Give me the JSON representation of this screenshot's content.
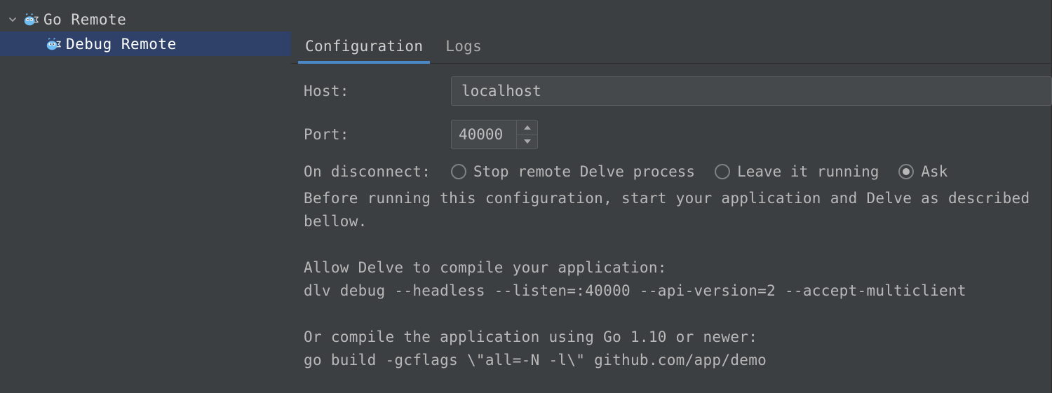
{
  "sidebar": {
    "nodes": [
      {
        "label": "Go Remote",
        "expanded": true
      },
      {
        "label": "Debug Remote",
        "selected": true
      }
    ]
  },
  "main": {
    "tabs": [
      {
        "label": "Configuration",
        "active": true
      },
      {
        "label": "Logs",
        "active": false
      }
    ],
    "host_label": "Host:",
    "host_value": "localhost",
    "port_label": "Port:",
    "port_value": "40000",
    "on_disconnect_label": "On disconnect:",
    "on_disconnect_options": [
      {
        "label": "Stop remote Delve process",
        "selected": false
      },
      {
        "label": "Leave it running",
        "selected": false
      },
      {
        "label": "Ask",
        "selected": true
      }
    ],
    "instructions_text": "Before running this configuration, start your application and Delve as described bellow.\n\nAllow Delve to compile your application:\ndlv debug --headless --listen=:40000 --api-version=2 --accept-multiclient\n\nOr compile the application using Go 1.10 or newer:\ngo build -gcflags \\\"all=-N -l\\\" github.com/app/demo"
  }
}
